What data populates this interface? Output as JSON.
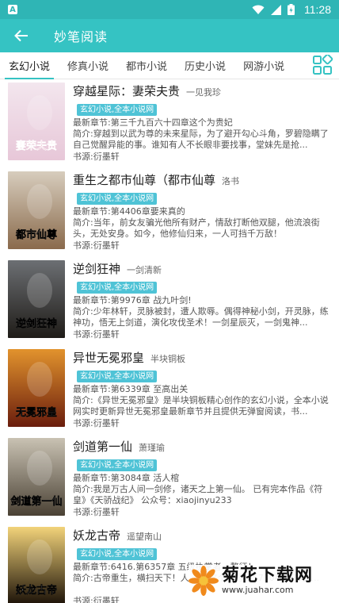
{
  "status": {
    "app_letter": "A",
    "time": "11:28"
  },
  "header": {
    "title": "妙笔阅读"
  },
  "tabs": [
    "玄幻小说",
    "修真小说",
    "都市小说",
    "历史小说",
    "网游小说"
  ],
  "books": [
    {
      "title": "穿越星际：妻荣夫贵",
      "author": "一见我珍",
      "tag": "玄幻小说,全本小说网",
      "latest": "最新章节:第三千九百六十四章这个为贵妃",
      "intro": "简介:穿越到以武为尊的未来星际，为了避开勾心斗角，罗碧隐瞒了自己觉醒异能的事。谁知有人不长眼非要找事，堂妹先是抢...",
      "source": "书源:衍墨轩",
      "cover_text": "妻荣夫贵",
      "cover_colors": [
        "#f3e6ee",
        "#e7c7d8"
      ]
    },
    {
      "title": "重生之都市仙尊（都市仙尊",
      "author": "洛书",
      "tag": "玄幻小说,全本小说网",
      "latest": "最新章节:第4406章要来真的",
      "intro": "简介:当年，前女友骗光他所有财产，情敌打断他双腿，他流浪街头，无处安身。如今，他修仙归来，一人可挡千万敌！",
      "source": "书源:衍墨轩",
      "cover_text": "都市仙尊",
      "cover_colors": [
        "#d7cdbd",
        "#8a6a4c"
      ]
    },
    {
      "title": "逆剑狂神",
      "author": "一剑清新",
      "tag": "玄幻小说,全本小说网",
      "latest": "最新章节:第9976章 战九叶剑!",
      "intro": "简介:少年林轩，灵脉被封，遭人欺辱。偶得神秘小剑，开灵脉，练神功，悟无上剑道，演化攻伐圣术！一剑星辰灭，一剑鬼神...",
      "source": "书源:衍墨轩",
      "cover_text": "逆剑狂神",
      "cover_colors": [
        "#6c6f73",
        "#1f1c18"
      ]
    },
    {
      "title": "异世无冕邪皇",
      "author": "半块铜板",
      "tag": "玄幻小说,全本小说网",
      "latest": "最新章节:第6339章 至高出关",
      "intro": "简介:《异世无冕邪皇》是半块铜板精心创作的玄幻小说，全本小说网实时更新异世无冕邪皇最新章节并且提供无弹窗阅读，书...",
      "source": "书源:衍墨轩",
      "cover_text": "无冕邪皇",
      "cover_colors": [
        "#e2932d",
        "#6a1d0d"
      ]
    },
    {
      "title": "剑道第一仙",
      "author": "萧瑾瑜",
      "tag": "玄幻小说,全本小说网",
      "latest": "最新章节:第3084章 活人棺",
      "intro": "简介:我是万古人间一剑修，诸天之上第一仙。 已有完本作品《符皇》《天骄战纪》 公众号：xiaojinyu233",
      "source": "书源:衍墨轩",
      "cover_text": "剑道第一仙",
      "cover_colors": [
        "#c9c2b3",
        "#4a4134"
      ]
    },
    {
      "title": "妖龙古帝",
      "author": "遥望南山",
      "tag": "玄幻小说,全本小说网",
      "latest": "最新章节:6416.第6357章 五级执掌者，赘征！",
      "intro": "简介:古帝重生，横扫天下！人... 加这个群号【573048376】...",
      "source": "书源:衍墨轩",
      "cover_text": "妖龙古帝",
      "cover_colors": [
        "#f2d37a",
        "#1c1208"
      ]
    }
  ],
  "watermark": {
    "name": "菊花下载网",
    "url": "www.juahar.com"
  }
}
